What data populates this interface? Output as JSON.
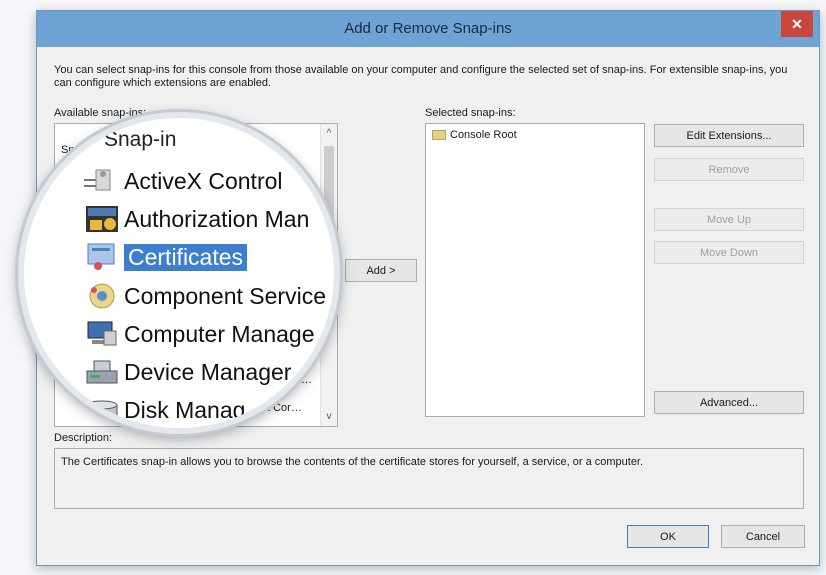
{
  "dialog": {
    "title": "Add or Remove Snap-ins",
    "close_glyph": "✕",
    "intro": "You can select snap-ins for this console from those available on your computer and configure the selected set of snap-ins. For extensible snap-ins, you can configure which extensions are enabled."
  },
  "available": {
    "label": "Available snap-ins:",
    "header_partial": "Sn",
    "scroll_up": "^",
    "scroll_down": "v",
    "partial_text_1": "…",
    "partial_text_2": "…",
    "partial_text_3": "t Cor…"
  },
  "magnifier": {
    "header": "Snap-in",
    "items": [
      {
        "label": "ActiveX Control",
        "icon": "activex-icon"
      },
      {
        "label": "Authorization Man",
        "icon": "authorization-icon"
      },
      {
        "label": "Certificates",
        "icon": "certificates-icon",
        "selected": true
      },
      {
        "label": "Component Service",
        "icon": "component-services-icon"
      },
      {
        "label": "Computer Manage",
        "icon": "computer-management-icon"
      },
      {
        "label": "Device Manager",
        "icon": "device-manager-icon"
      },
      {
        "label": "Disk Manag",
        "icon": "disk-management-icon"
      }
    ]
  },
  "add_button": "Add >",
  "selected": {
    "label": "Selected snap-ins:",
    "items": [
      {
        "label": "Console Root",
        "icon": "folder-icon"
      }
    ]
  },
  "side_buttons": {
    "edit_extensions": "Edit Extensions...",
    "remove": "Remove",
    "move_up": "Move Up",
    "move_down": "Move Down",
    "advanced": "Advanced..."
  },
  "description": {
    "label": "Description:",
    "text": "The Certificates snap-in allows you to browse the contents of the certificate stores for yourself, a service, or a computer."
  },
  "footer": {
    "ok": "OK",
    "cancel": "Cancel"
  },
  "colors": {
    "titlebar": "#6ea3d6",
    "close": "#c9463d",
    "selection": "#3c7fcf"
  }
}
